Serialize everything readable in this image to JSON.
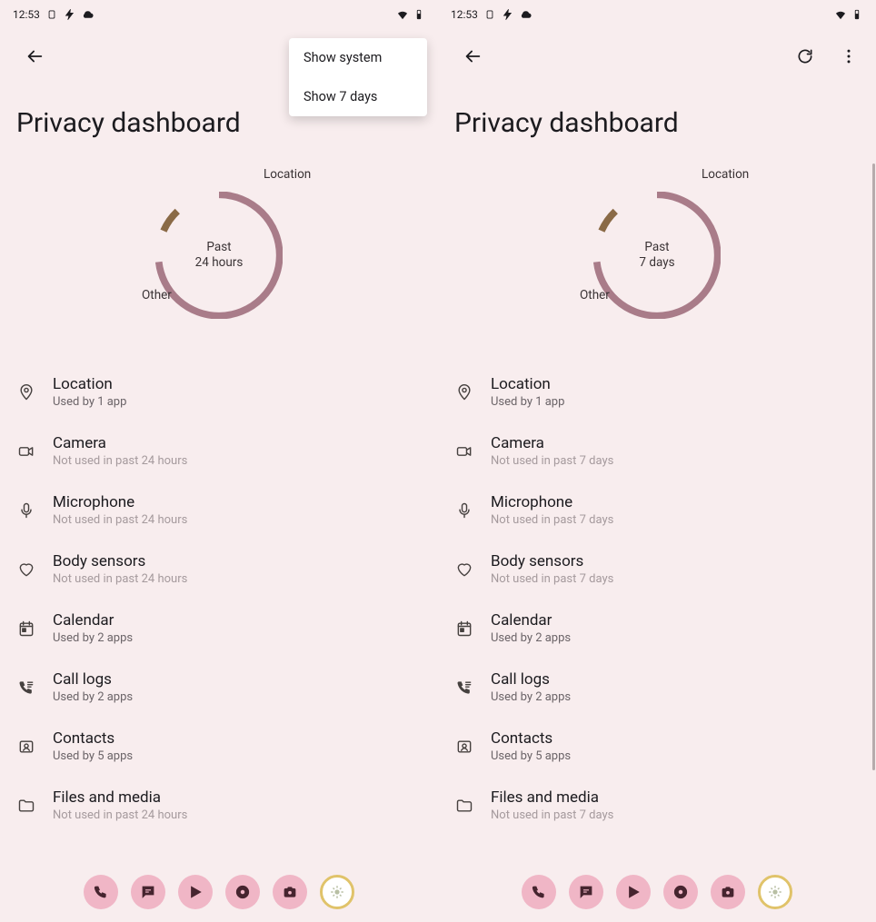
{
  "statusbar": {
    "time": "12:53"
  },
  "screens": {
    "left": {
      "title": "Privacy dashboard",
      "donut_center_l1": "Past",
      "donut_center_l2": "24 hours",
      "donut_label_top": "Location",
      "donut_label_bottom": "Other",
      "menu": {
        "item1": "Show system",
        "item2": "Show 7 days"
      },
      "perms": [
        {
          "title": "Location",
          "sub": "Used by 1 app",
          "muted": false
        },
        {
          "title": "Camera",
          "sub": "Not used in past 24 hours",
          "muted": true
        },
        {
          "title": "Microphone",
          "sub": "Not used in past 24 hours",
          "muted": true
        },
        {
          "title": "Body sensors",
          "sub": "Not used in past 24 hours",
          "muted": true
        },
        {
          "title": "Calendar",
          "sub": "Used by 2 apps",
          "muted": false
        },
        {
          "title": "Call logs",
          "sub": "Used by 2 apps",
          "muted": false
        },
        {
          "title": "Contacts",
          "sub": "Used by 5 apps",
          "muted": false
        },
        {
          "title": "Files and media",
          "sub": "Not used in past 24 hours",
          "muted": true
        }
      ]
    },
    "right": {
      "title": "Privacy dashboard",
      "donut_center_l1": "Past",
      "donut_center_l2": "7 days",
      "donut_label_top": "Location",
      "donut_label_bottom": "Other",
      "perms": [
        {
          "title": "Location",
          "sub": "Used by 1 app",
          "muted": false
        },
        {
          "title": "Camera",
          "sub": "Not used in past 7 days",
          "muted": true
        },
        {
          "title": "Microphone",
          "sub": "Not used in past 7 days",
          "muted": true
        },
        {
          "title": "Body sensors",
          "sub": "Not used in past 7 days",
          "muted": true
        },
        {
          "title": "Calendar",
          "sub": "Used by 2 apps",
          "muted": false
        },
        {
          "title": "Call logs",
          "sub": "Used by 2 apps",
          "muted": false
        },
        {
          "title": "Contacts",
          "sub": "Used by 5 apps",
          "muted": false
        },
        {
          "title": "Files and media",
          "sub": "Not used in past 7 days",
          "muted": true
        }
      ]
    }
  },
  "chart_data": [
    {
      "type": "pie",
      "title": "Permission usage, past 24 hours",
      "series": [
        {
          "name": "Location",
          "value": 8
        },
        {
          "name": "Other",
          "value": 92
        }
      ],
      "colors": {
        "Location": "#8a6a46",
        "Other": "#a97c89"
      }
    },
    {
      "type": "pie",
      "title": "Permission usage, past 7 days",
      "series": [
        {
          "name": "Location",
          "value": 8
        },
        {
          "name": "Other",
          "value": 92
        }
      ],
      "colors": {
        "Location": "#8a6a46",
        "Other": "#a97c89"
      }
    }
  ]
}
